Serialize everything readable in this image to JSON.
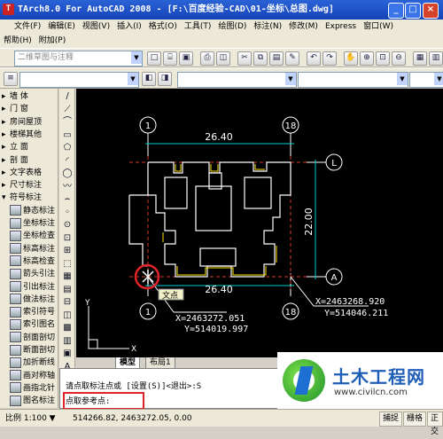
{
  "window": {
    "title": "TArch8.0 For AutoCAD 2008 - [F:\\百度经验-CAD\\01-坐标\\总图.dwg]",
    "minimize": "_",
    "restore": "□",
    "close": "×"
  },
  "menu": {
    "row1": [
      "文件(F)",
      "编辑(E)",
      "视图(V)",
      "插入(I)",
      "格式(O)",
      "工具(T)",
      "绘图(D)",
      "标注(N)",
      "修改(M)",
      "Express",
      "窗口(W)"
    ],
    "row2": [
      "帮助(H)",
      "附加(P)"
    ]
  },
  "toolbar": {
    "layer_combo": "二维草图与注释"
  },
  "left_panel": {
    "items": [
      {
        "mark": "▸",
        "label": "墙 体"
      },
      {
        "mark": "▸",
        "label": "门 窗"
      },
      {
        "mark": "▸",
        "label": "房间屋顶"
      },
      {
        "mark": "▸",
        "label": "楼梯其他"
      },
      {
        "mark": "▸",
        "label": "立 面"
      },
      {
        "mark": "▸",
        "label": "剖 面"
      },
      {
        "mark": "▸",
        "label": "文字表格"
      },
      {
        "mark": "▸",
        "label": "尺寸标注"
      },
      {
        "mark": "▾",
        "label": "符号标注"
      },
      {
        "mark": "",
        "label": "静态标注"
      },
      {
        "mark": "",
        "label": "坐标标注"
      },
      {
        "mark": "",
        "label": "坐标检查"
      },
      {
        "mark": "",
        "label": "标高标注"
      },
      {
        "mark": "",
        "label": "标高检查"
      },
      {
        "mark": "",
        "label": "箭头引注"
      },
      {
        "mark": "",
        "label": "引出标注"
      },
      {
        "mark": "",
        "label": "做法标注"
      },
      {
        "mark": "",
        "label": "索引符号"
      },
      {
        "mark": "",
        "label": "索引图名"
      },
      {
        "mark": "",
        "label": "剖面剖切"
      },
      {
        "mark": "",
        "label": "断面剖切"
      },
      {
        "mark": "",
        "label": "加折断线"
      },
      {
        "mark": "",
        "label": "画对称轴"
      },
      {
        "mark": "",
        "label": "画指北针"
      },
      {
        "mark": "",
        "label": "图名标注"
      }
    ]
  },
  "draw_bar": [
    "/",
    "⟋",
    "⌒",
    "▭",
    "⬠",
    "◜",
    "◯",
    "〰",
    "⌢",
    "◦",
    "⊙",
    "⊡",
    "⊞",
    "⬚",
    "▦",
    "▤",
    "⊟",
    "◫",
    "▩",
    "▥",
    "▣",
    "A"
  ],
  "drawing": {
    "axis_top_left": "1",
    "axis_top_right": "18",
    "axis_bottom_left": "1",
    "axis_bottom_right": "18",
    "axis_right_top": "L",
    "axis_right_bottom": "A",
    "dim_top": "26.40",
    "dim_bottom": "26.40",
    "dim_right": "22.00",
    "coord_left_x": "X=2463272.051",
    "coord_left_y": "Y=514019.997",
    "coord_right_x": "X=2463268.920",
    "coord_right_y": "Y=514046.211",
    "tooltip": "文点",
    "ucs_x": "X",
    "ucs_y": "Y"
  },
  "tabs": [
    "模型",
    "布局1"
  ],
  "command": {
    "line1": "请点取标注点或 [设置(S)]<退出>:S",
    "line2": "点取参考点:"
  },
  "status": {
    "scale": "比例 1:100 ▼",
    "coords": "514266.82, 2463272.05, 0.00",
    "buttons": [
      "捕捉",
      "栅格",
      "正交"
    ]
  },
  "watermark": {
    "name": "土木工程网",
    "url": "www.civilcn.com"
  }
}
